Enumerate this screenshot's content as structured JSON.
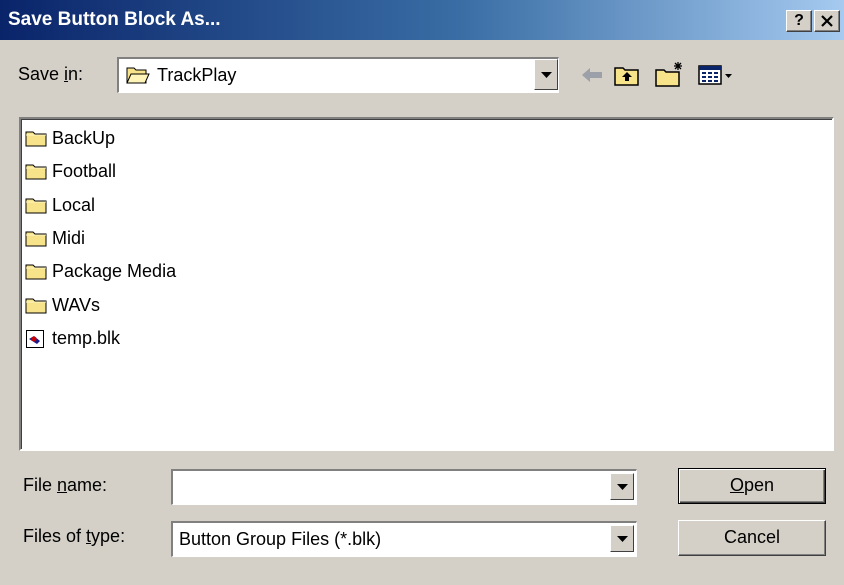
{
  "window": {
    "title": "Save Button Block As...",
    "help_label": "?",
    "close_label": "✕"
  },
  "save_in": {
    "label_pre": "Save ",
    "label_accel": "i",
    "label_post": "n:",
    "value": "TrackPlay",
    "folder_icon": "folder-open-icon"
  },
  "toolbar": {
    "icons": [
      "back-arrow-icon",
      "up-one-level-icon",
      "create-new-folder-icon",
      "view-menu-icon"
    ]
  },
  "files": [
    {
      "name": "BackUp",
      "icon": "folder-icon"
    },
    {
      "name": "Football",
      "icon": "folder-icon"
    },
    {
      "name": "Local",
      "icon": "folder-icon"
    },
    {
      "name": "Midi",
      "icon": "folder-icon"
    },
    {
      "name": "Package Media",
      "icon": "folder-icon"
    },
    {
      "name": "WAVs",
      "icon": "folder-icon"
    },
    {
      "name": "temp.blk",
      "icon": "file-icon"
    }
  ],
  "file_name": {
    "label_pre": "File ",
    "label_accel": "n",
    "label_post": "ame:",
    "value": ""
  },
  "file_type": {
    "label_pre": "Files of ",
    "label_accel": "t",
    "label_post": "ype:",
    "value": "Button Group Files (*.blk)"
  },
  "buttons": {
    "open_accel": "O",
    "open_rest": "pen",
    "cancel": "Cancel"
  },
  "colors": {
    "title_start": "#0a246a",
    "title_end": "#a6caf0",
    "dialog_bg": "#d4d0c8",
    "folder": "#f7e38a"
  }
}
